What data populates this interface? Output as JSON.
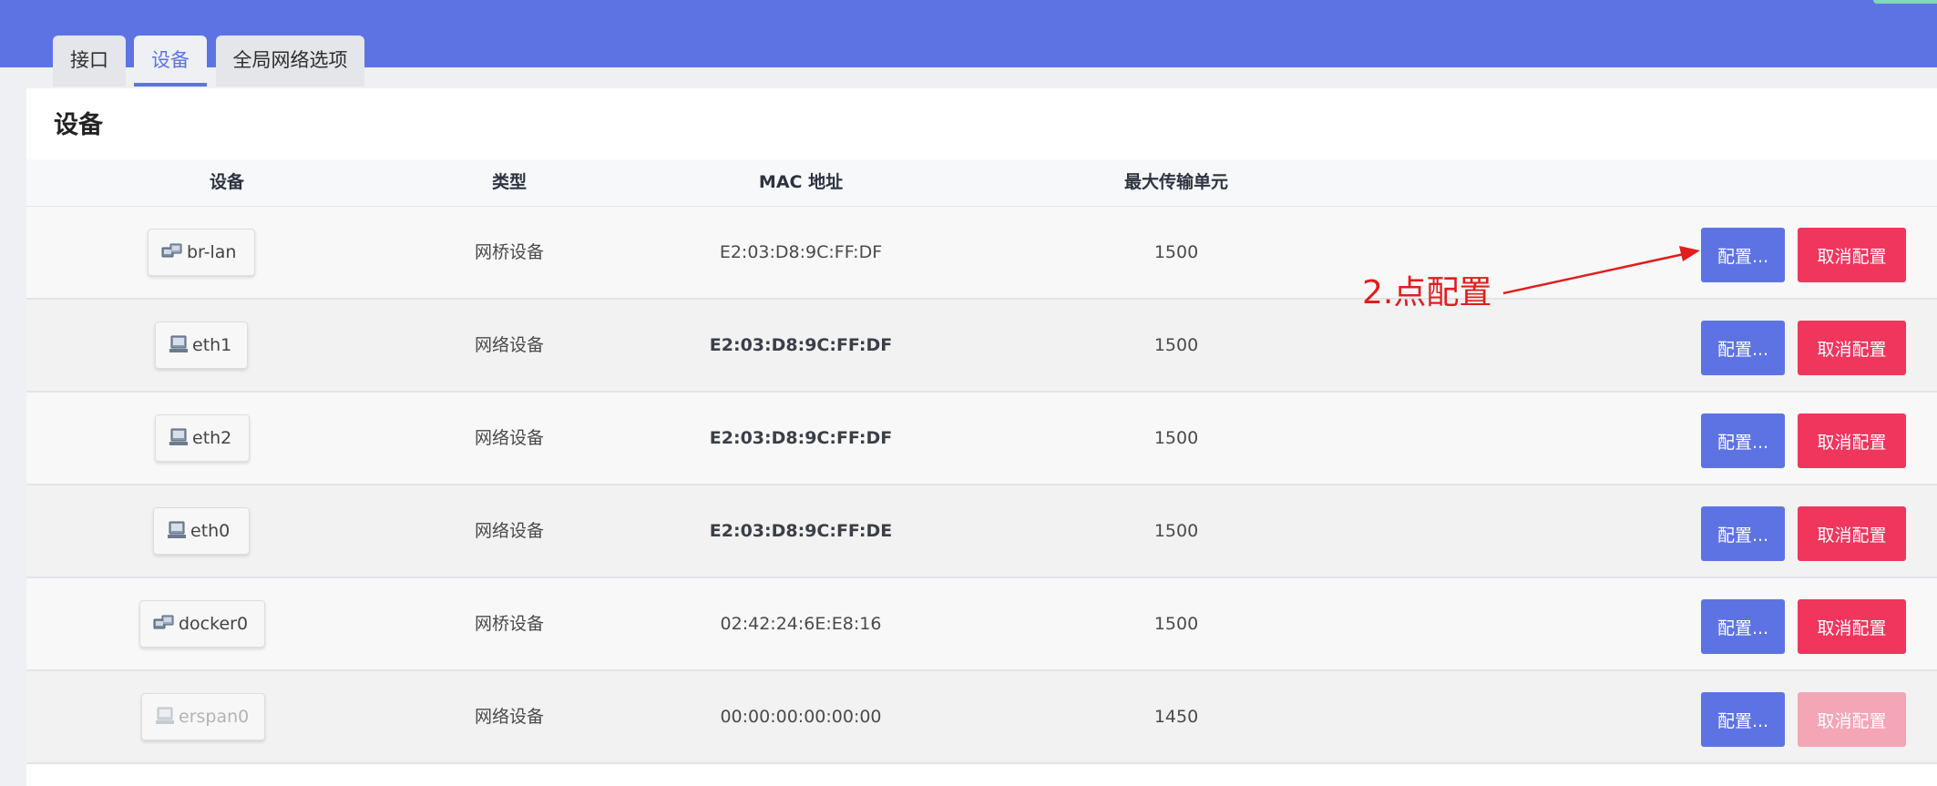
{
  "tabs": [
    {
      "label": "接口",
      "active": false
    },
    {
      "label": "设备",
      "active": true
    },
    {
      "label": "全局网络选项",
      "active": false
    }
  ],
  "section_title": "设备",
  "table": {
    "headers": {
      "device": "设备",
      "type": "类型",
      "mac": "MAC 地址",
      "mtu": "最大传输单元"
    },
    "rows": [
      {
        "device": "br-lan",
        "icon": "bridge-device-icon",
        "type": "网桥设备",
        "mac": "E2:03:D8:9C:FF:DF",
        "mtu": "1500",
        "config": "配置...",
        "unconfig": "取消配置",
        "unconfig_enabled": true
      },
      {
        "device": "eth1",
        "icon": "network-device-icon",
        "type": "网络设备",
        "mac": "E2:03:D8:9C:FF:DF",
        "mtu": "1500",
        "config": "配置...",
        "unconfig": "取消配置",
        "unconfig_enabled": true
      },
      {
        "device": "eth2",
        "icon": "network-device-icon",
        "type": "网络设备",
        "mac": "E2:03:D8:9C:FF:DF",
        "mtu": "1500",
        "config": "配置...",
        "unconfig": "取消配置",
        "unconfig_enabled": true
      },
      {
        "device": "eth0",
        "icon": "network-device-icon",
        "type": "网络设备",
        "mac": "E2:03:D8:9C:FF:DE",
        "mtu": "1500",
        "config": "配置...",
        "unconfig": "取消配置",
        "unconfig_enabled": true
      },
      {
        "device": "docker0",
        "icon": "bridge-device-icon",
        "type": "网桥设备",
        "mac": "02:42:24:6E:E8:16",
        "mtu": "1500",
        "config": "配置...",
        "unconfig": "取消配置",
        "unconfig_enabled": true
      },
      {
        "device": "erspan0",
        "icon": "network-device-icon",
        "type": "网络设备",
        "mac": "00:00:00:00:00:00",
        "mtu": "1450",
        "config": "配置...",
        "unconfig": "取消配置",
        "unconfig_enabled": false
      }
    ]
  },
  "annotation": {
    "text": "2.点配置",
    "color": "#e11d1d"
  },
  "colors": {
    "header": "#5d73e4",
    "primary_button": "#5d73e4",
    "danger_button": "#f0365d",
    "danger_button_disabled": "#f4a5b6"
  }
}
